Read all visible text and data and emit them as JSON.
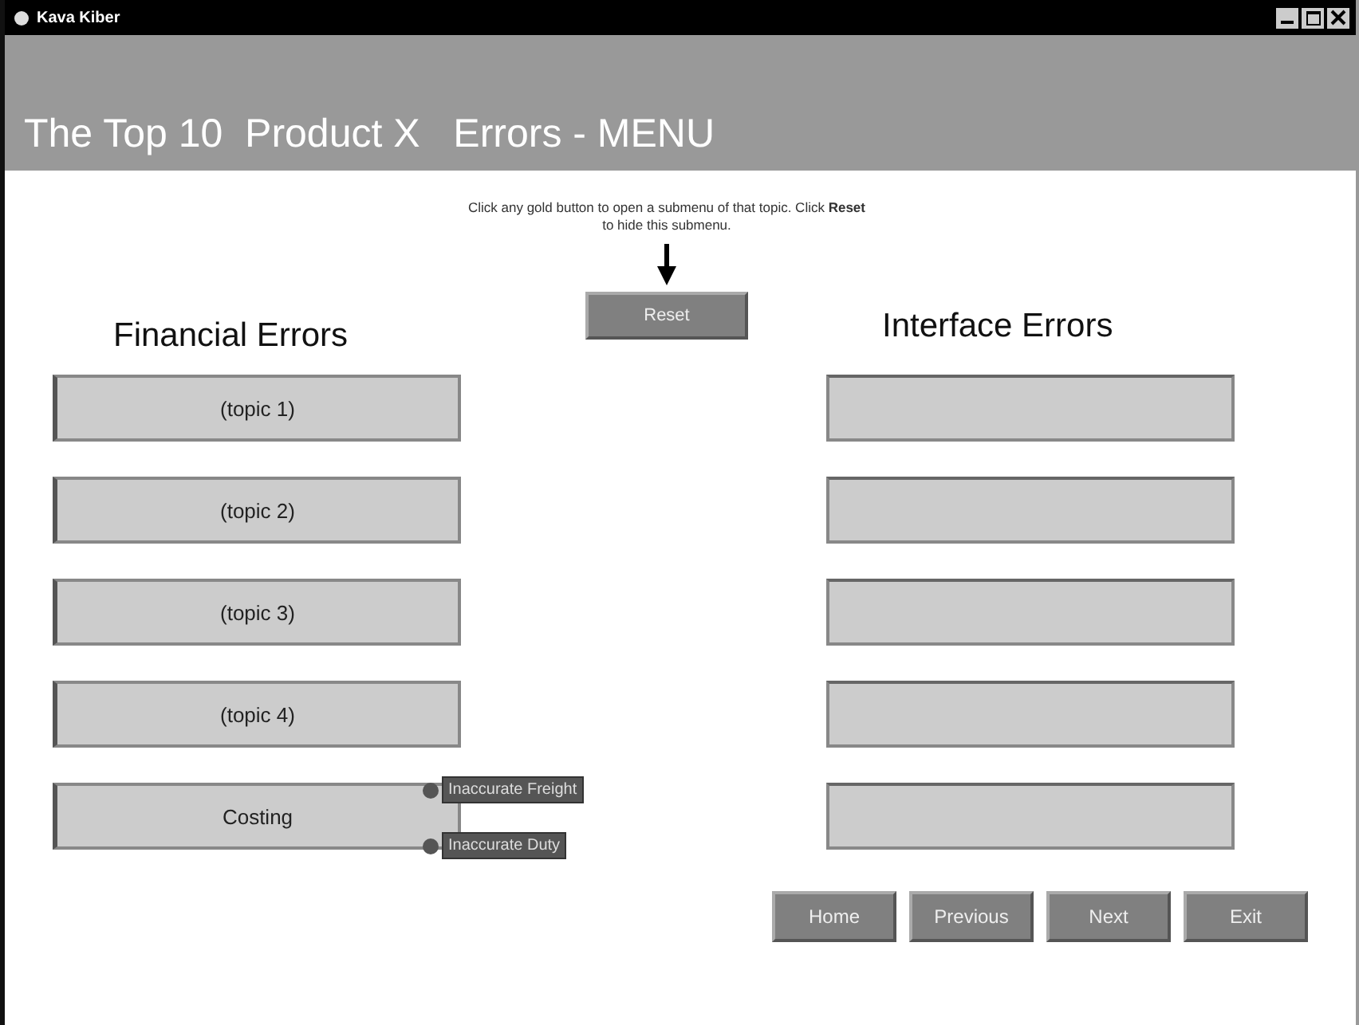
{
  "window": {
    "title": "Kava Kiber"
  },
  "header": {
    "title": "The Top 10  Product X   Errors - MENU"
  },
  "instructions": "Click any gold button to open a submenu of that topic. Click **Reset** to hide this submenu.",
  "reset_button": "Reset",
  "financial": {
    "heading": "Financial Errors",
    "topics": [
      {
        "label": "(topic 1)"
      },
      {
        "label": "(topic 2)"
      },
      {
        "label": "(topic 3)"
      },
      {
        "label": "(topic 4)"
      },
      {
        "label": "Costing",
        "submenu": [
          "Inaccurate Freight",
          "Inaccurate Duty"
        ]
      }
    ]
  },
  "interface": {
    "heading": "Interface Errors"
  },
  "nav_buttons": [
    "Home",
    "Previous",
    "Next",
    "Exit"
  ]
}
